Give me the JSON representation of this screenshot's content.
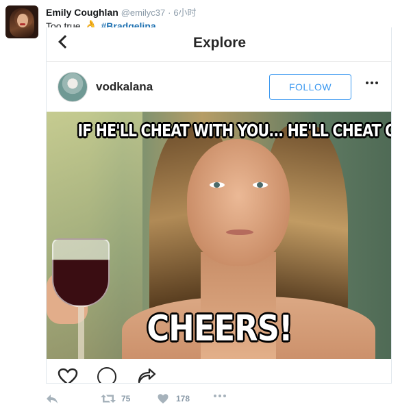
{
  "tweet": {
    "author_name": "Emily Coughlan",
    "author_handle": "@emilyc37",
    "separator": "·",
    "timestamp": "6小时",
    "text": "Too true",
    "emoji": "👌",
    "hashtag": "#Bradgelina",
    "retweet_count": "75",
    "like_count": "178"
  },
  "instagram": {
    "header_title": "Explore",
    "username": "vodkalana",
    "follow_label": "FOLLOW",
    "meme_caption_top": "IF HE'LL CHEAT WITH YOU... HE'LL CHEAT ON YOU",
    "meme_caption_bottom": "CHEERS!"
  },
  "colors": {
    "accent": "#3897f0",
    "hashtag": "#1b6fb0",
    "muted": "#8a9aa8"
  },
  "icons": {
    "instagram_actions": [
      "heart-icon",
      "comment-icon",
      "share-icon"
    ],
    "tweet_actions": [
      "reply-icon",
      "retweet-icon",
      "like-icon",
      "more-icon"
    ]
  }
}
